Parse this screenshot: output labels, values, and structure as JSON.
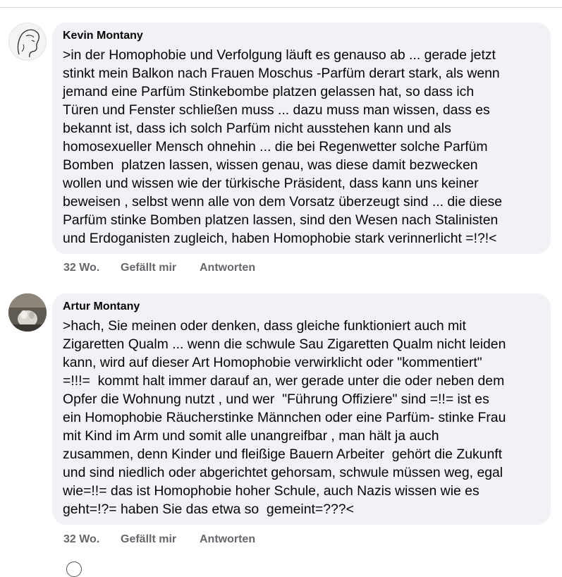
{
  "comments": [
    {
      "author": "Kevin Montany",
      "text": ">in der Homophobie und Verfolgung läuft es genauso ab ... gerade jetzt\nstinkt mein Balkon nach Frauen Moschus -Parfüm derart stark, als wenn\njemand eine Parfüm Stinkebombe platzen gelassen hat, so dass ich\nTüren und Fenster schließen muss ... dazu muss man wissen, dass es\nbekannt ist, dass ich solch Parfüm nicht ausstehen kann und als\nhomosexueller Mensch ohnehin ... die bei Regenwetter solche Parfüm\nBomben  platzen lassen, wissen genau, was diese damit bezwecken\nwollen und wissen wie der türkische Präsident, dass kann uns keiner\nbeweisen , selbst wenn alle von dem Vorsatz überzeugt sind ... die diese\nParfüm stinke Bomben platzen lassen, sind den Wesen nach Stalinisten\nund Erdoganisten zugleich, haben Homophobie stark verinnerlicht =!?!<",
      "time": "32 Wo.",
      "like_label": "Gefällt mir",
      "reply_label": "Antworten"
    },
    {
      "author": "Artur Montany",
      "text": ">hach, Sie meinen oder denken, dass gleiche funktioniert auch mit\nZigaretten Qualm ... wenn die schwule Sau Zigaretten Qualm nicht leiden\nkann, wird auf dieser Art Homophobie verwirklicht oder \"kommentiert\"\n=!!!=  kommt halt immer darauf an, wer gerade unter die oder neben dem\nOpfer die Wohnung nutzt , und wer  \"Führung Offiziere\" sind =!!= ist es\nein Homophobie Räucherstinke Männchen oder eine Parfüm- stinke Frau\nmit Kind im Arm und somit alle unangreifbar , man hält ja auch\nzusammen, denn Kinder und fleißige Bauern Arbeiter  gehört die Zukunft\nund sind niedlich oder abgerichtet gehorsam, schwule müssen weg, egal\nwie=!!= das ist Homophobie hoher Schule, auch Nazis wissen wie es\ngeht=!?= haben Sie das etwa so  gemeint=???<",
      "time": "32 Wo.",
      "like_label": "Gefällt mir",
      "reply_label": "Antworten"
    }
  ],
  "colors": {
    "bubble": "#f0f2f5",
    "text": "#050505",
    "meta": "#65676b"
  }
}
